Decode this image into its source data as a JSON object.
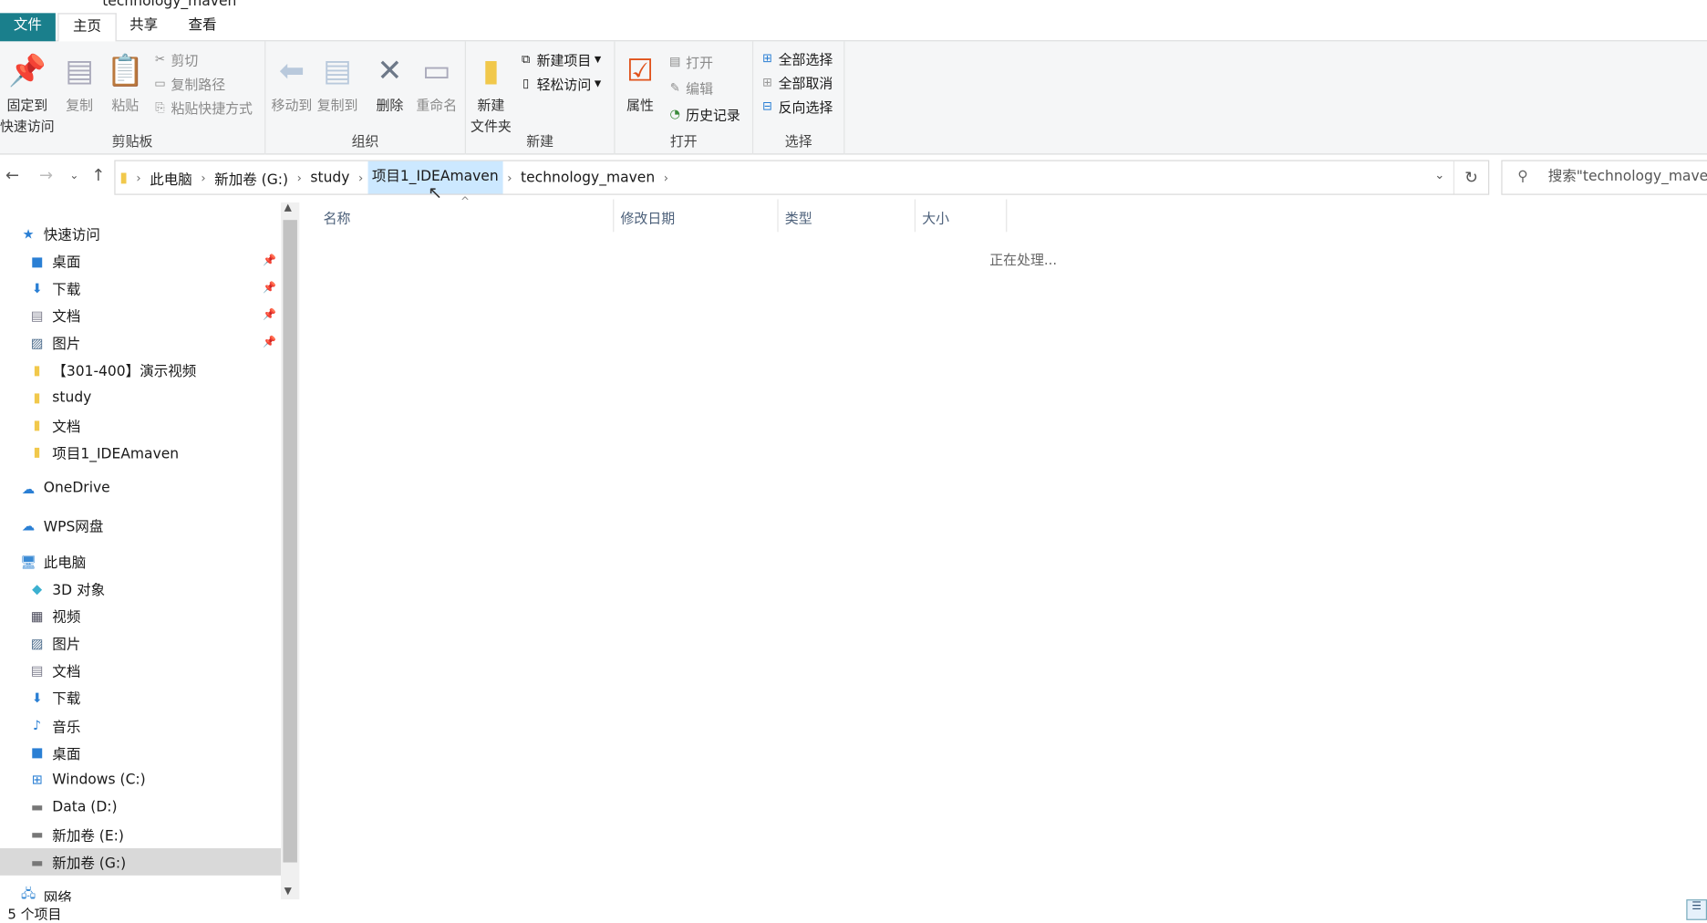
{
  "window": {
    "title": "technology_maven"
  },
  "tabs": [
    "文件",
    "主页",
    "共享",
    "查看"
  ],
  "ribbon": {
    "clipboard": {
      "label": "剪贴板",
      "pin": "固定到\n快速访问",
      "pin1": "固定到",
      "pin2": "快速访问",
      "copy": "复制",
      "paste": "粘贴",
      "cut": "剪切",
      "copy_path": "复制路径",
      "paste_shortcut": "粘贴快捷方式"
    },
    "organize": {
      "label": "组织",
      "move_to": "移动到",
      "copy_to": "复制到",
      "delete": "删除",
      "rename": "重命名"
    },
    "new": {
      "label": "新建",
      "new_folder1": "新建",
      "new_folder2": "文件夹",
      "new_item": "新建项目",
      "easy_access": "轻松访问"
    },
    "open": {
      "label": "打开",
      "properties": "属性",
      "open": "打开",
      "edit": "编辑",
      "history": "历史记录"
    },
    "select": {
      "label": "选择",
      "select_all": "全部选择",
      "select_none": "全部取消",
      "invert": "反向选择"
    }
  },
  "address": {
    "crumbs": [
      "此电脑",
      "新加卷 (G:)",
      "study",
      "项目1_IDEAmaven",
      "technology_maven"
    ],
    "search_placeholder": "搜索\"technology_maven\""
  },
  "columns": [
    "名称",
    "修改日期",
    "类型",
    "大小"
  ],
  "content": {
    "status_message": "正在处理..."
  },
  "sidebar": {
    "quick_access": "快速访问",
    "quick_items": [
      "桌面",
      "下载",
      "文档",
      "图片",
      "【301-400】演示视频",
      "study",
      "文档",
      "项目1_IDEAmaven"
    ],
    "onedrive": "OneDrive",
    "wps": "WPS网盘",
    "this_pc": "此电脑",
    "pc_items": [
      "3D 对象",
      "视频",
      "图片",
      "文档",
      "下载",
      "音乐",
      "桌面",
      "Windows (C:)",
      "Data (D:)",
      "新加卷 (E:)",
      "新加卷 (G:)"
    ],
    "network": "网络"
  },
  "status": {
    "count": "5 个项目"
  }
}
